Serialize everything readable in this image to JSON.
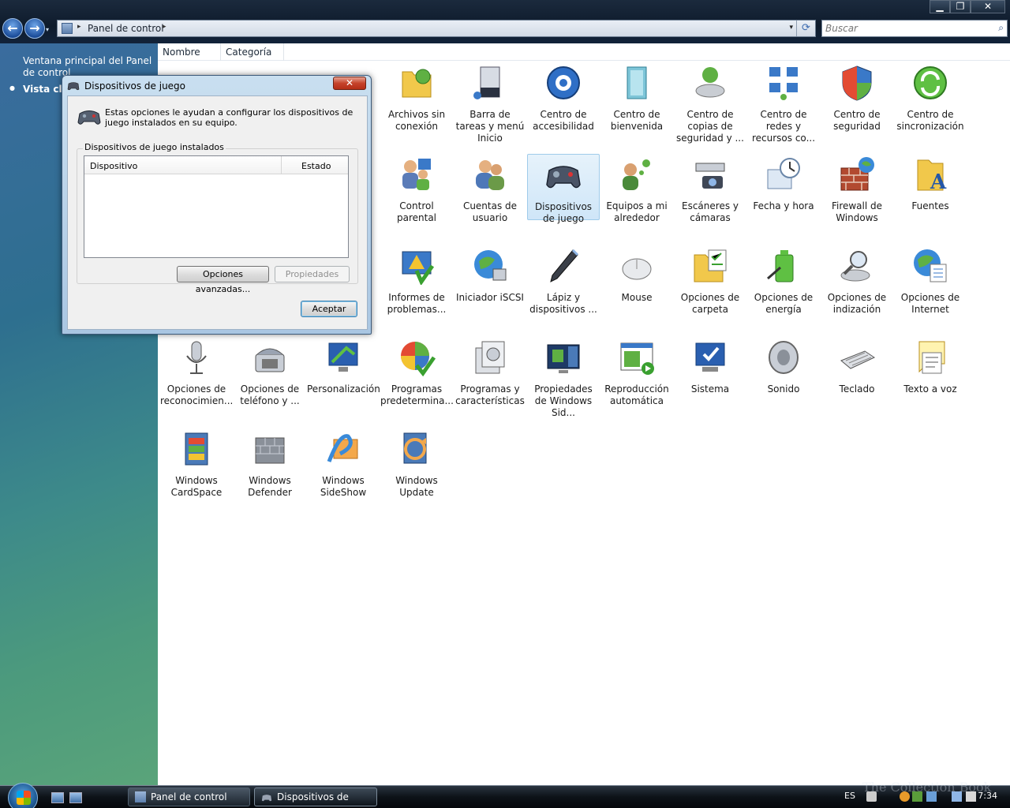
{
  "window": {
    "controls": {
      "minimize": "▁",
      "maximize": "❐",
      "close": "✕"
    }
  },
  "nav": {
    "back": "←",
    "forward": "→",
    "recent": "▾"
  },
  "address": {
    "crumb": "Panel de control",
    "sep": "▸",
    "dropdown": "▾",
    "refresh": "⟳"
  },
  "search": {
    "placeholder": "Buscar",
    "icon": "⌕"
  },
  "left_pane": {
    "home_link": "Ventana principal del Panel de control",
    "classic_view": "Vista clás"
  },
  "columns": [
    "Nombre",
    "Categoría"
  ],
  "items": [
    {
      "label": "Archivos sin conexión",
      "icon": "folder-sync-icon"
    },
    {
      "label": "Barra de tareas y menú Inicio",
      "icon": "taskbar-icon"
    },
    {
      "label": "Centro de accesibilidad",
      "icon": "accessibility-icon"
    },
    {
      "label": "Centro de bienvenida",
      "icon": "welcome-icon"
    },
    {
      "label": "Centro de copias de seguridad y ...",
      "icon": "backup-icon"
    },
    {
      "label": "Centro de redes y recursos co...",
      "icon": "network-icon"
    },
    {
      "label": "Centro de seguridad",
      "icon": "shield-icon"
    },
    {
      "label": "Centro de sincronización",
      "icon": "sync-icon"
    },
    {
      "label": "Control parental",
      "icon": "parental-icon"
    },
    {
      "label": "Cuentas de usuario",
      "icon": "users-icon"
    },
    {
      "label": "Dispositivos de juego",
      "icon": "gamepad-icon"
    },
    {
      "label": "Equipos a mi alrededor",
      "icon": "people-near-icon"
    },
    {
      "label": "Escáneres y cámaras",
      "icon": "scanner-icon"
    },
    {
      "label": "Fecha y hora",
      "icon": "clock-icon"
    },
    {
      "label": "Firewall de Windows",
      "icon": "firewall-icon"
    },
    {
      "label": "Fuentes",
      "icon": "fonts-icon"
    },
    {
      "label": "Informes de problemas...",
      "icon": "problem-reports-icon"
    },
    {
      "label": "Iniciador iSCSI",
      "icon": "iscsi-icon"
    },
    {
      "label": "Lápiz y dispositivos ...",
      "icon": "pen-icon"
    },
    {
      "label": "Mouse",
      "icon": "mouse-icon"
    },
    {
      "label": "Opciones de carpeta",
      "icon": "folder-options-icon"
    },
    {
      "label": "Opciones de energía",
      "icon": "power-icon"
    },
    {
      "label": "Opciones de indización",
      "icon": "indexing-icon"
    },
    {
      "label": "Opciones de Internet",
      "icon": "internet-icon"
    },
    {
      "label": "Opciones de reconocimien...",
      "icon": "microphone-icon"
    },
    {
      "label": "Opciones de teléfono y ...",
      "icon": "phone-icon"
    },
    {
      "label": "Personalización",
      "icon": "personalization-icon"
    },
    {
      "label": "Programas predetermina...",
      "icon": "default-programs-icon"
    },
    {
      "label": "Programas y características",
      "icon": "programs-icon"
    },
    {
      "label": "Propiedades de Windows Sid...",
      "icon": "sidebar-icon"
    },
    {
      "label": "Reproducción automática",
      "icon": "autoplay-icon"
    },
    {
      "label": "Sistema",
      "icon": "system-icon"
    },
    {
      "label": "Sonido",
      "icon": "speaker-icon"
    },
    {
      "label": "Teclado",
      "icon": "keyboard-icon"
    },
    {
      "label": "Texto a voz",
      "icon": "speech-icon"
    },
    {
      "label": "Windows CardSpace",
      "icon": "cardspace-icon"
    },
    {
      "label": "Windows Defender",
      "icon": "defender-icon"
    },
    {
      "label": "Windows SideShow",
      "icon": "sideshow-icon"
    },
    {
      "label": "Windows Update",
      "icon": "update-icon"
    }
  ],
  "dialog": {
    "title": "Dispositivos de juego",
    "close": "✕",
    "description": "Estas opciones le ayudan a configurar los dispositivos de juego instalados en su equipo.",
    "group_label": "Dispositivos de juego instalados",
    "col_device": "Dispositivo",
    "col_status": "Estado",
    "btn_advanced": "Opciones avanzadas...",
    "btn_properties": "Propiedades",
    "btn_ok": "Aceptar"
  },
  "taskbar": {
    "buttons": [
      {
        "label": "Panel de control"
      },
      {
        "label": "Dispositivos de juego"
      }
    ],
    "lang": "ES",
    "clock": "7:34"
  },
  "watermark": "The Collection Book"
}
